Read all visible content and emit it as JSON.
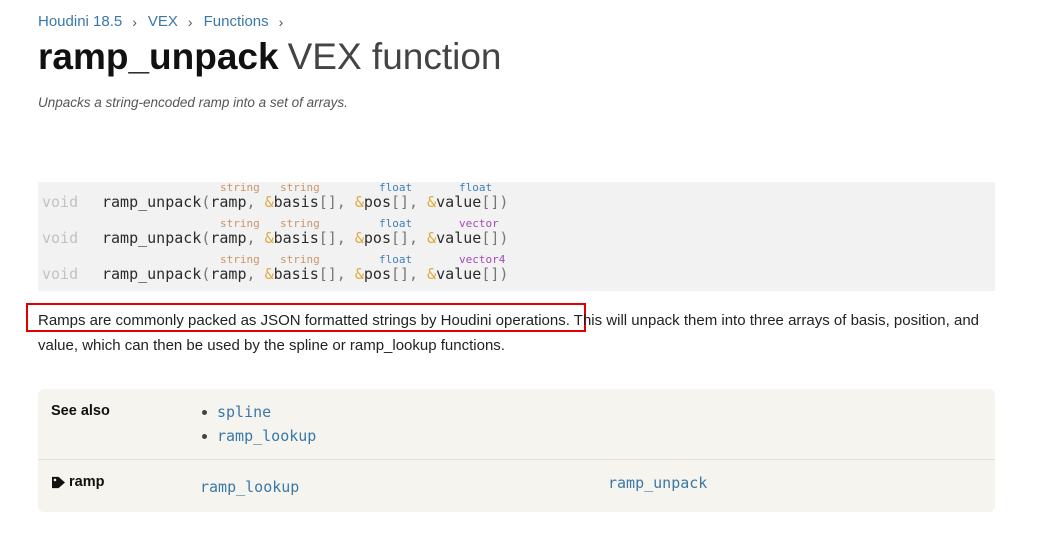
{
  "breadcrumb": {
    "items": [
      "Houdini 18.5",
      "VEX",
      "Functions"
    ]
  },
  "title": {
    "name": "ramp_unpack",
    "kind": "VEX function"
  },
  "summary": "Unpacks a string-encoded ramp into a set of arrays.",
  "usage": [
    {
      "ret": "void",
      "fn": "ramp_unpack",
      "types": [
        "string",
        "string",
        "float",
        "float"
      ],
      "params": [
        "ramp",
        "basis",
        "pos",
        "value"
      ]
    },
    {
      "ret": "void",
      "fn": "ramp_unpack",
      "types": [
        "string",
        "string",
        "float",
        "vector"
      ],
      "params": [
        "ramp",
        "basis",
        "pos",
        "value"
      ]
    },
    {
      "ret": "void",
      "fn": "ramp_unpack",
      "types": [
        "string",
        "string",
        "float",
        "vector4"
      ],
      "params": [
        "ramp",
        "basis",
        "pos",
        "value"
      ]
    }
  ],
  "description": {
    "highlighted": "Ramps are commonly packed as JSON formatted strings by Houdini operations.",
    "rest": " This will unpack them into three arrays of basis, position, and value, which can then be used by the spline or ramp_lookup functions."
  },
  "related": {
    "see_also_label": "See also",
    "see_also": [
      "spline",
      "ramp_lookup"
    ],
    "tag_label": "ramp",
    "tag_icon": "tag-icon",
    "tag_links": [
      "ramp_lookup",
      "ramp_unpack"
    ]
  }
}
